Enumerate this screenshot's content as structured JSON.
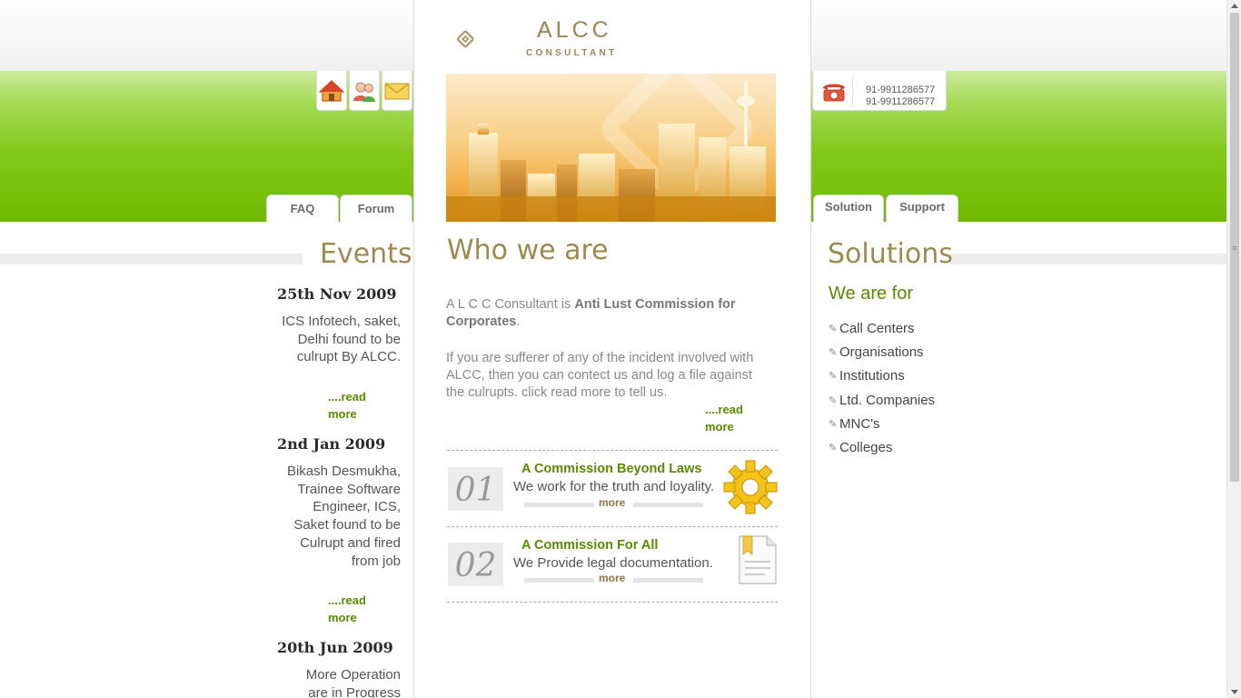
{
  "header": {
    "logo_text": "ALCC",
    "logo_sub": "CONSULTANT",
    "phones": [
      "91-9911286577",
      "91-9911286577"
    ]
  },
  "left_tabs": [
    "FAQ",
    "Forum"
  ],
  "right_tabs": [
    "Solution",
    "Support"
  ],
  "icons": [
    "home-icon",
    "users-icon",
    "mail-icon",
    "phone-icon"
  ],
  "events": {
    "title": "Events",
    "items": [
      {
        "date": "25th Nov 2009",
        "text": "ICS Infotech, saket, Delhi found to be culrupt By ALCC.",
        "more": "....read more"
      },
      {
        "date": "2nd Jan 2009",
        "text": "Bikash Desmukha, Trainee Software Engineer, ICS, Saket found to be Culrupt and fired from job",
        "more": "....read more"
      },
      {
        "date": "20th Jun 2009",
        "text": "More Operation are in Progress"
      }
    ]
  },
  "who": {
    "title": "Who we are",
    "p1_plain": "A L C C Consultant is ",
    "p1_bold": "Anti Lust Commission for Corporates",
    "p1_end": ".",
    "p2": "If you are sufferer of any of the incident involved with ALCC, then you can contect us and log a file against the culrupts. click read more to tell us.",
    "more": "....read more"
  },
  "features": [
    {
      "num": "01",
      "title": "A Commission Beyond Laws",
      "desc": "We work for the truth and loyality.",
      "more": "more"
    },
    {
      "num": "02",
      "title": "A Commission For All",
      "desc": "We Provide legal documentation.",
      "more": "more"
    }
  ],
  "solutions": {
    "title": "Solutions",
    "subtitle": "We are for",
    "items": [
      "Call Centers",
      "Organisations",
      "Institutions",
      "Ltd. Companies",
      "MNC's",
      "Colleges"
    ]
  }
}
